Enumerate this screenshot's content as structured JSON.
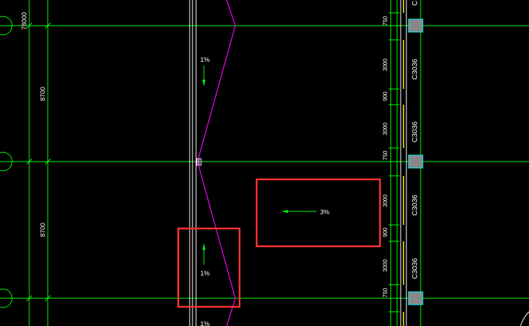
{
  "colors": {
    "background": "#000000",
    "grid": "#00ff00",
    "slope_line": "#ff00ff",
    "annotation_box": "#ff3333",
    "window": "#ffff00",
    "column": "#888888",
    "column_border": "#00ffff",
    "text": "#ffffff"
  },
  "axis_dims": {
    "top": "78000",
    "upper_bay": "8700",
    "lower_bay": "8700"
  },
  "slopes": {
    "top_marker": "1%",
    "middle_marker": "1%",
    "boxed_marker": "3%",
    "bottom_marker": "1%"
  },
  "wall_dims": [
    "750",
    "3000",
    "900",
    "3000",
    "750",
    "3000",
    "900",
    "3000",
    "750"
  ],
  "window_tags": [
    "C",
    "C3036",
    "C3036",
    "C3036",
    "C3036"
  ],
  "icons": {
    "slope_arrow": "arrow-icon",
    "column": "column-square-icon",
    "axis_bubble": "axis-bubble-icon"
  }
}
